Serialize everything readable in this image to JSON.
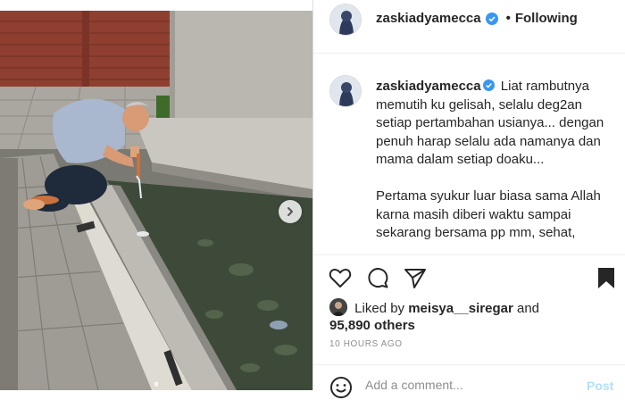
{
  "header": {
    "username": "zaskiadyamecca",
    "separator": "•",
    "follow_status": "Following"
  },
  "caption": {
    "username": "zaskiadyamecca",
    "paragraph_1": "Liat rambutnya memutih ku gelisah, selalu deg2an setiap pertambahan usianya... dengan penuh harap selalu ada namanya dan mama dalam setiap doaku...",
    "paragraph_2": "Pertama syukur luar biasa sama Allah karna masih diberi waktu sampai sekarang bersama pp mm, sehat,"
  },
  "likes": {
    "prefix": "Liked by",
    "liker": "meisya__siregar",
    "conjunction": "and",
    "others": "95,890 others"
  },
  "timestamp": "10 HOURS AGO",
  "comment": {
    "placeholder": "Add a comment...",
    "post_label": "Post"
  },
  "colors": {
    "verified_blue": "#3897f0",
    "post_button_disabled": "#b2dffc",
    "muted_text": "#8e8e8e"
  },
  "icons": [
    "heart-icon",
    "comment-icon",
    "share-icon",
    "bookmark-icon",
    "emoji-icon",
    "verified-icon",
    "chevron-right-icon"
  ]
}
